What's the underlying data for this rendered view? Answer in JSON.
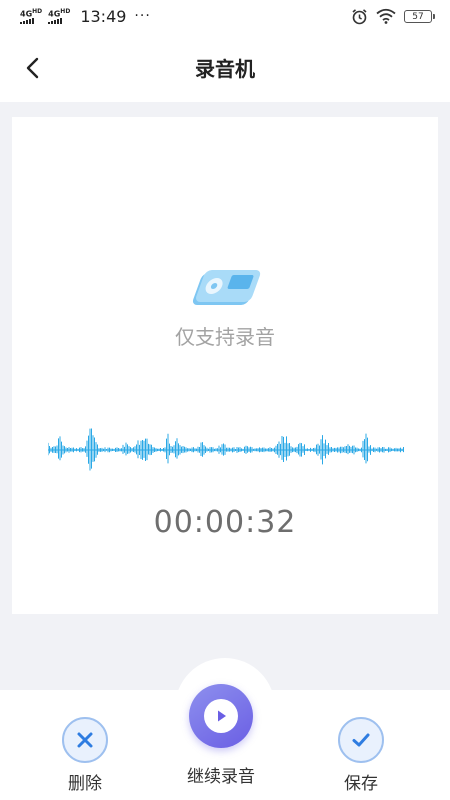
{
  "status_bar": {
    "network_1": "4G",
    "network_1_sup": "HD",
    "network_2": "4G",
    "network_2_sup": "HD",
    "time": "13:49",
    "more": "···",
    "battery": "57"
  },
  "header": {
    "title": "录音机",
    "back_icon": "chevron-left-icon"
  },
  "recorder": {
    "hint": "仅支持录音",
    "duration": "00:00:32",
    "device_icon": "music-player-icon",
    "waveform_color": "#2aa8e6"
  },
  "actions": {
    "delete_label": "删除",
    "continue_label": "继续录音",
    "save_label": "保存"
  },
  "colors": {
    "accent": "#6a5ee4",
    "ring": "#9ec0ef",
    "action_icon": "#2f7de1"
  }
}
